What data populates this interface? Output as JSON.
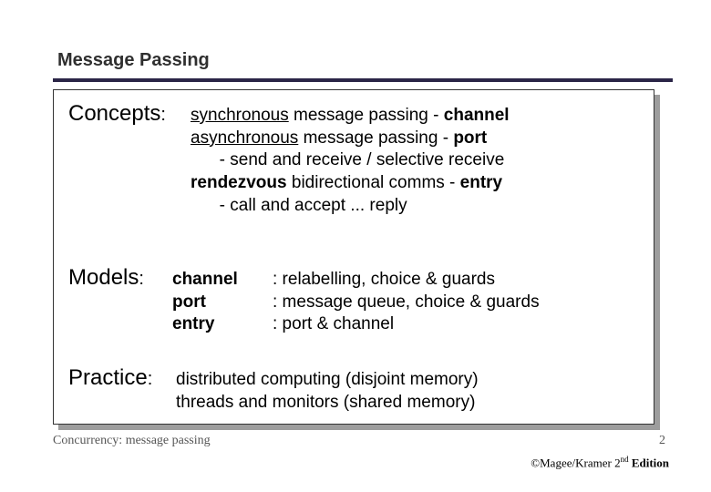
{
  "title": "Message Passing",
  "concepts": {
    "label": "Concepts",
    "colon": ":",
    "line1_pre": "synchronous",
    "line1_mid": " message passing - ",
    "line1_end": "channel",
    "line2_pre": "asynchronous",
    "line2_mid": " message passing - ",
    "line2_end": "port",
    "line3_pre": "      - send and receive / selective receive",
    "line4_pre": "rendezvous",
    "line4_mid": "  bidirectional comms - ",
    "line4_end": "entry",
    "line5_pre": "      - call and accept ... reply"
  },
  "models": {
    "label": "Models",
    "colon": ":",
    "terms": {
      "t1": "channel",
      "t2": "port",
      "t3": "entry"
    },
    "defs": {
      "d1": ": relabelling, choice & guards",
      "d2": ": message queue, choice & guards",
      "d3": ": port & channel"
    }
  },
  "practice": {
    "label": "Practice",
    "colon": ":",
    "line1": "distributed computing (disjoint memory)",
    "line2": "threads and monitors  (shared memory)"
  },
  "footer": {
    "left": "Concurrency: message passing",
    "page": "2",
    "credit_pre": "©Magee/Kramer ",
    "credit_num": "2",
    "credit_sup": "nd",
    "credit_post": " Edition"
  }
}
